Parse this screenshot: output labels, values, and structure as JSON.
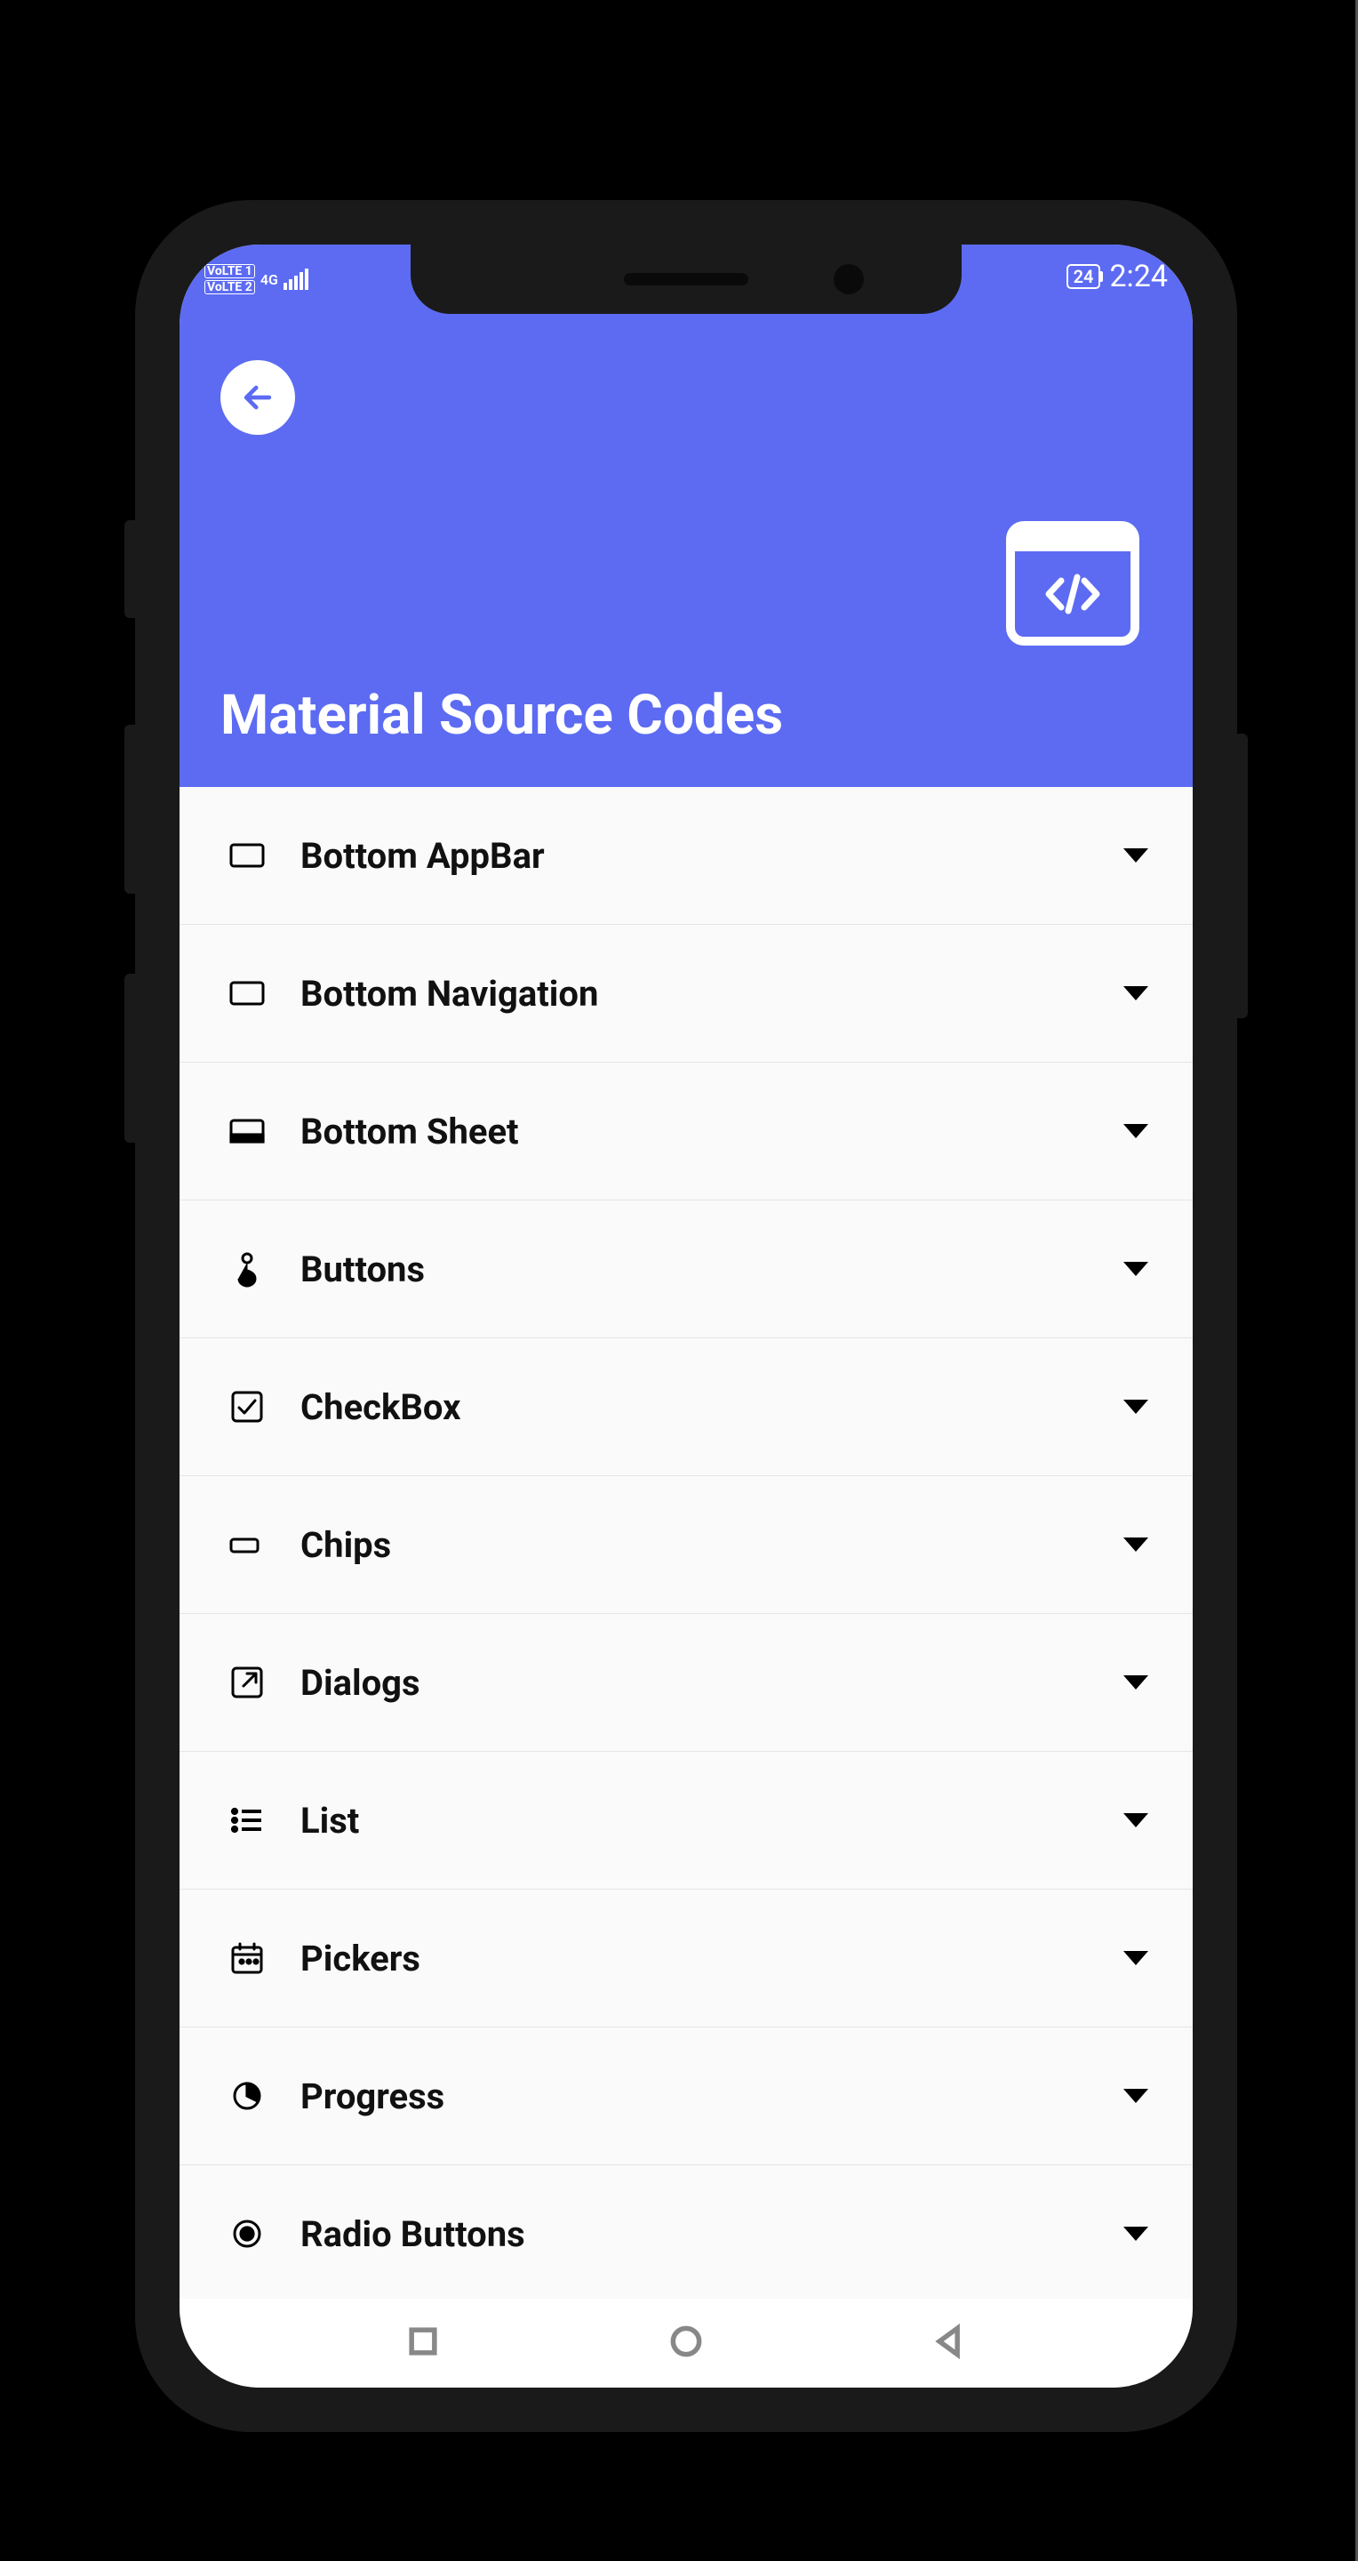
{
  "status": {
    "volte1": "VoLTE",
    "volte1_sub": "1",
    "volte2": "VoLTE",
    "volte2_sub": "2",
    "net": "4G",
    "battery": "24",
    "time": "2:24"
  },
  "header": {
    "title": "Material Source Codes"
  },
  "items": [
    {
      "label": "Bottom AppBar",
      "icon": "panel-bottom-outline"
    },
    {
      "label": "Bottom Navigation",
      "icon": "panel-bottom-outline"
    },
    {
      "label": "Bottom Sheet",
      "icon": "panel-bottom-filled"
    },
    {
      "label": "Buttons",
      "icon": "touch"
    },
    {
      "label": "CheckBox",
      "icon": "checkbox"
    },
    {
      "label": "Chips",
      "icon": "chip"
    },
    {
      "label": "Dialogs",
      "icon": "open-external"
    },
    {
      "label": "List",
      "icon": "list"
    },
    {
      "label": "Pickers",
      "icon": "calendar"
    },
    {
      "label": "Progress",
      "icon": "progress"
    },
    {
      "label": "Radio Buttons",
      "icon": "radio"
    }
  ]
}
